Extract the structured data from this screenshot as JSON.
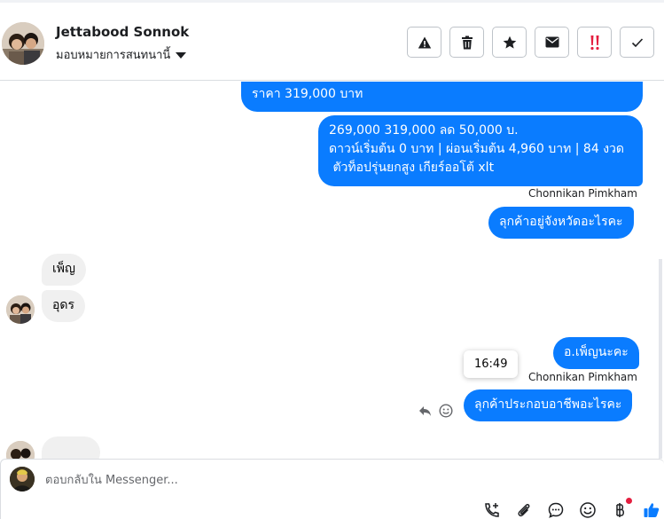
{
  "header": {
    "contact_name": "Jettabood Sonnok",
    "assign_label": "มอบหมายการสนทนานี้"
  },
  "actions": [
    {
      "name": "spam-button",
      "icon": "warning-icon"
    },
    {
      "name": "delete-button",
      "icon": "trash-icon"
    },
    {
      "name": "star-button",
      "icon": "star-icon"
    },
    {
      "name": "mark-unread-button",
      "icon": "envelope-icon"
    },
    {
      "name": "mark-important-button",
      "icon": "double-exclamation-icon"
    },
    {
      "name": "mark-done-button",
      "icon": "check-icon"
    }
  ],
  "messages": {
    "m1_line1": "ราคา 319,000 บาท",
    "m2_line1": "269,000 319,000 ลด 50,000 บ.",
    "m2_line2": "ดาวน์เริ่มต้น 0 บาท | ผ่อนเริ่มต้น 4,960 บาท | 84 งวด",
    "m2_line3": " ตัวท็อปรุ่นยกสูง เกียร์ออโต้ xlt",
    "sender_1": "Chonnikan Pimkham",
    "m3": "ลุกค้าอยู่จังหวัดอะไรคะ",
    "m4": "เพ็ญ",
    "m5": "อุดร",
    "m6": "อ.เพ็ญนะคะ",
    "sender_2": "Chonnikan Pimkham",
    "m7": "ลุกค้าประกอบอาชีพอะไรคะ",
    "tooltip_time": "16:49"
  },
  "composer": {
    "placeholder": "ตอบกลับใน Messenger...",
    "tools": [
      "add-call-icon",
      "paperclip-icon",
      "saved-reply-icon",
      "emoji-icon",
      "baht-payment-icon",
      "thumbs-up-icon"
    ],
    "accent": "#0a7cff",
    "notification_color": "#e41e3f"
  }
}
